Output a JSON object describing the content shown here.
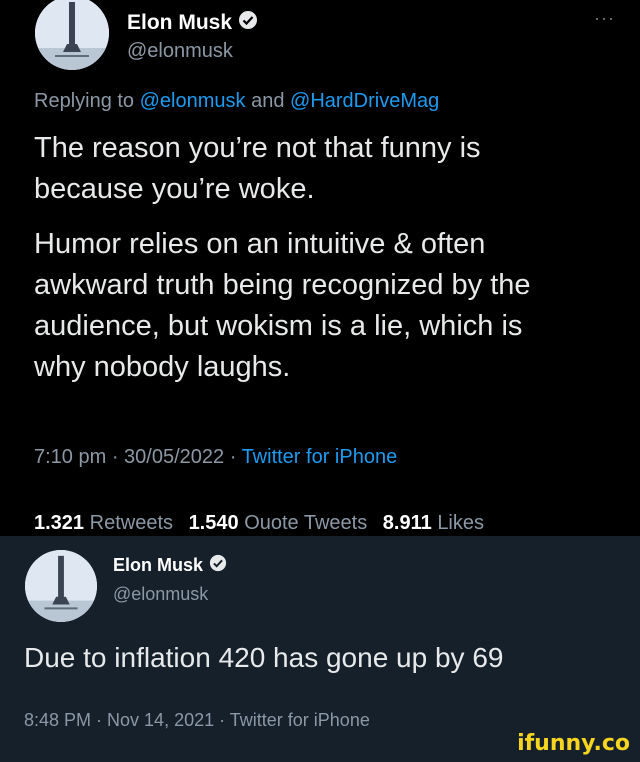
{
  "tweet1": {
    "name": "Elon Musk",
    "handle": "@elonmusk",
    "more": "···",
    "replying_prefix": "Replying to ",
    "replying_user1": "@elonmusk",
    "replying_and": " and ",
    "replying_user2": "@HardDriveMag",
    "paragraph1_line1": "The reason you’re not that funny is",
    "paragraph1_line2": "because you’re woke.",
    "paragraph2_line1": "Humor relies on an intuitive & often",
    "paragraph2_line2": "awkward truth being recognized by the",
    "paragraph2_line3": "audience, but wokism is a lie, which is",
    "paragraph2_line4": "why nobody laughs.",
    "time": "7:10 pm · 30/05/2022 · ",
    "source": "Twitter for iPhone",
    "retweets_count": "1.321",
    "retweets_label": "Retweets",
    "quotes_count": "1.540",
    "quotes_label": "Ouote Tweets",
    "likes_count": "8.911",
    "likes_label": "Likes"
  },
  "tweet2": {
    "name": "Elon Musk",
    "handle": "@elonmusk",
    "text": "Due to inflation 420 has gone up by 69",
    "meta": "8:48 PM · Nov 14, 2021 · Twitter for iPhone"
  },
  "watermark": "ifunny.co",
  "colors": {
    "verified": "#1d9bf0",
    "link": "#1d9bf0",
    "watermark": "#f7d41e",
    "panel2_bg": "#15202b"
  }
}
